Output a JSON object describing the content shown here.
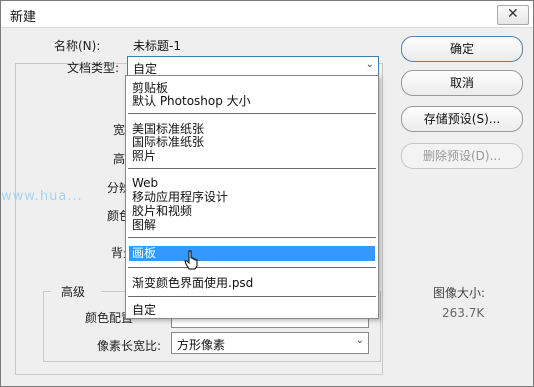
{
  "window": {
    "title": "新建",
    "close_glyph": "✕"
  },
  "form": {
    "name_label": "名称(N):",
    "name_value": "未标题-1",
    "doctype_label": "文档类型:",
    "doctype_value": "自定",
    "width_label": "宽",
    "height_label": "高",
    "resolution_label": "分辨",
    "color_mode_label": "颜色",
    "background_label": "背景",
    "advanced_label": "高级",
    "color_profile_label": "颜色配置",
    "pixel_ratio_label": "像素长宽比:",
    "pixel_ratio_value": "方形像素"
  },
  "buttons": {
    "ok": "确定",
    "cancel": "取消",
    "save_preset": "存储预设(S)...",
    "delete_preset": "删除预设(D)..."
  },
  "image_size": {
    "label": "图像大小:",
    "value": "263.7K"
  },
  "dropdown": {
    "items": [
      "剪贴板",
      "默认 Photoshop 大小",
      "美国标准纸张",
      "国际标准纸张",
      "照片",
      "Web",
      "移动应用程序设计",
      "胶片和视频",
      "图解",
      "画板",
      "渐变颜色界面使用.psd",
      "自定"
    ],
    "highlighted": "画板"
  },
  "watermark": "www.hua..."
}
